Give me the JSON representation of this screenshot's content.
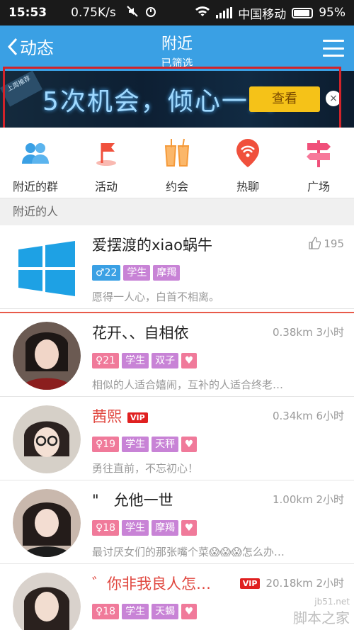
{
  "status_bar": {
    "time": "15:53",
    "speed": "0.75K/s",
    "carrier": "中国移动",
    "battery": "95%"
  },
  "header": {
    "back_label": "动态",
    "title": "附近",
    "subtitle": "已筛选"
  },
  "ad": {
    "tag": "上周推荐",
    "text": "5次机会，倾心一人",
    "button": "查看",
    "close": "×"
  },
  "categories": [
    {
      "label": "附近的群",
      "icon": "group-icon",
      "color": "#3aa0e4"
    },
    {
      "label": "活动",
      "icon": "flag-icon",
      "color": "#f0503c"
    },
    {
      "label": "约会",
      "icon": "drinks-icon",
      "color": "#f59a3a"
    },
    {
      "label": "热聊",
      "icon": "wifi-pin-icon",
      "color": "#f0503c"
    },
    {
      "label": "广场",
      "icon": "signpost-icon",
      "color": "#f0507a"
    }
  ],
  "section_label": "附近的人",
  "people": [
    {
      "name": "爱摆渡的xiao蜗牛",
      "meta": "195",
      "gender_age": "♂22",
      "tag1": "学生",
      "tag2": "摩羯",
      "signature": "愿得一人心，白首不相离。"
    },
    {
      "name": "花开、、自相依",
      "meta": "0.38km 3小时",
      "gender_age": "♀21",
      "tag1": "学生",
      "tag2": "双子",
      "signature": "相似的人适合嬉闹，互补的人适合终老…"
    },
    {
      "name": "茜熙",
      "vip": "VIP",
      "meta": "0.34km 6小时",
      "gender_age": "♀19",
      "tag1": "学生",
      "tag2": "天秤",
      "signature": "勇往直前，不忘初心！"
    },
    {
      "name": "\"　允他一世",
      "meta": "1.00km 2小时",
      "gender_age": "♀18",
      "tag1": "学生",
      "tag2": "摩羯",
      "signature": "最讨厌女们的那张嘴个菜😱😱😱怎么办…"
    },
    {
      "name": "゛你非我良人怎…",
      "vip": "VIP",
      "meta": "20.18km 2小时",
      "gender_age": "♀18",
      "tag1": "学生",
      "tag2": "天蝎",
      "signature": ""
    }
  ],
  "watermark": {
    "url": "jb51.net",
    "cn": "脚本之家"
  }
}
